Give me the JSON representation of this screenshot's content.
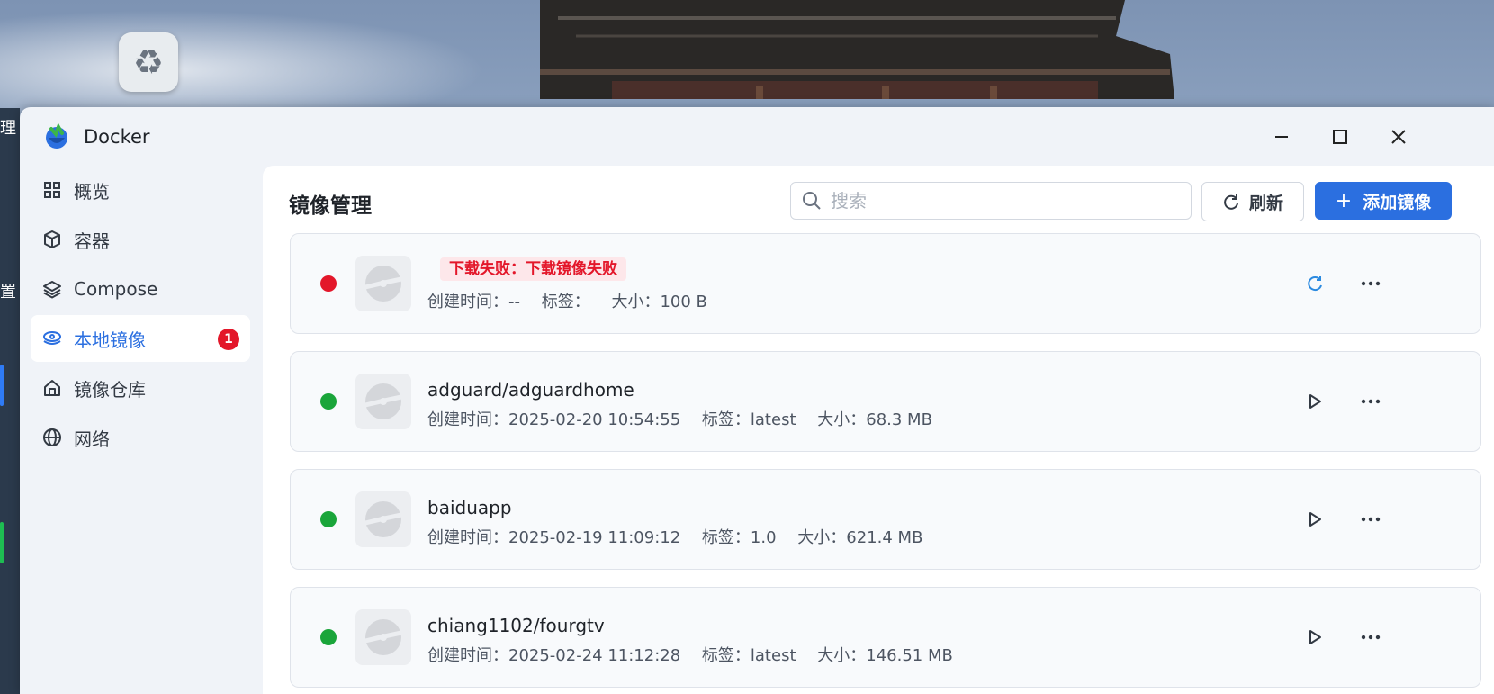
{
  "colors": {
    "accent": "#2b6fe0",
    "error": "#e3172a",
    "success": "#1aa53a"
  },
  "window": {
    "title": "Docker",
    "minimize_icon": "minimize-icon",
    "maximize_icon": "maximize-icon",
    "close_icon": "close-icon"
  },
  "desktop": {
    "recycle_icon": "recycle-bin-icon"
  },
  "sidebar": {
    "items": [
      {
        "label": "概览",
        "icon": "grid-icon"
      },
      {
        "label": "容器",
        "icon": "cube-icon"
      },
      {
        "label": "Compose",
        "icon": "layers-icon"
      },
      {
        "label": "本地镜像",
        "icon": "eye-icon",
        "badge": "1"
      },
      {
        "label": "镜像仓库",
        "icon": "home-icon"
      },
      {
        "label": "网络",
        "icon": "globe-icon"
      }
    ]
  },
  "main": {
    "title": "镜像管理",
    "search_placeholder": "搜索",
    "refresh_label": "刷新",
    "add_label": "添加镜像"
  },
  "images": [
    {
      "status": "error",
      "name": "",
      "error": "下载失败：下载镜像失败",
      "created": "创建时间：--",
      "tag": "标签：",
      "size": "大小：100 B",
      "action_icon": "retry-icon"
    },
    {
      "status": "ok",
      "name": "adguard/adguardhome",
      "error": "",
      "created": "创建时间：2025-02-20 10:54:55",
      "tag": "标签：latest",
      "size": "大小：68.3 MB",
      "action_icon": "play-icon"
    },
    {
      "status": "ok",
      "name": "baiduapp",
      "error": "",
      "created": "创建时间：2025-02-19 11:09:12",
      "tag": "标签：1.0",
      "size": "大小：621.4 MB",
      "action_icon": "play-icon"
    },
    {
      "status": "ok",
      "name": "chiang1102/fourgtv",
      "error": "",
      "created": "创建时间：2025-02-24 11:12:28",
      "tag": "标签：latest",
      "size": "大小：146.51 MB",
      "action_icon": "play-icon"
    }
  ]
}
